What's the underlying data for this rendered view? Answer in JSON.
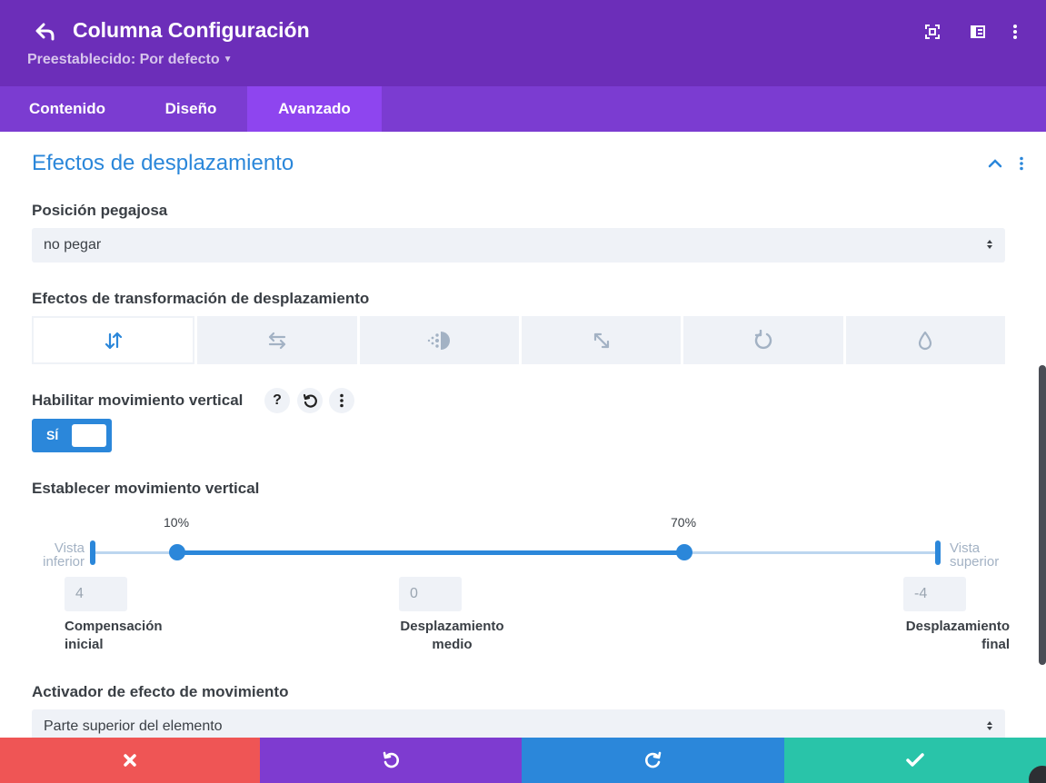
{
  "header": {
    "title": "Columna Configuración",
    "preset_label": "Preestablecido: Por defecto",
    "icons": [
      "back-icon",
      "focus-icon",
      "split-icon",
      "more-icon"
    ]
  },
  "tabs": [
    {
      "label": "Contenido",
      "active": false
    },
    {
      "label": "Diseño",
      "active": false
    },
    {
      "label": "Avanzado",
      "active": true
    }
  ],
  "section": {
    "title": "Efectos de desplazamiento"
  },
  "sticky": {
    "label": "Posición pegajosa",
    "value": "no pegar"
  },
  "transform": {
    "label": "Efectos de transformación de desplazamiento",
    "effects": [
      "vertical-motion-icon",
      "horizontal-motion-icon",
      "fade-icon",
      "scale-icon",
      "rotate-icon",
      "blur-icon"
    ],
    "active_index": 0
  },
  "vertical_enable": {
    "label": "Habilitar movimiento vertical",
    "toggle_label": "SÍ",
    "enabled": true
  },
  "vertical_set": {
    "label": "Establecer movimiento vertical",
    "start_pct_label": "10%",
    "end_pct_label": "70%",
    "start_pct": 10,
    "end_pct": 70,
    "bottom_view_label": "Vista inferior",
    "top_view_label": "Vista superior",
    "initial_offset": "4",
    "mid_offset": "0",
    "final_offset": "-4",
    "initial_label": "Compensación inicial",
    "mid_label": "Desplazamiento medio",
    "final_label": "Desplazamiento final"
  },
  "trigger": {
    "label": "Activador de efecto de movimiento",
    "value": "Parte superior del elemento"
  },
  "colors": {
    "header": "#6c2eb9",
    "tabs": "#7b3cd1",
    "tab_active": "#8e45ef",
    "accent": "#2b87da",
    "cancel": "#ef5555",
    "undo": "#7e3bd0",
    "redo": "#2b87da",
    "save": "#29c4a9"
  },
  "footer": {
    "buttons": [
      "close-icon",
      "undo-icon",
      "redo-icon",
      "check-icon"
    ]
  }
}
